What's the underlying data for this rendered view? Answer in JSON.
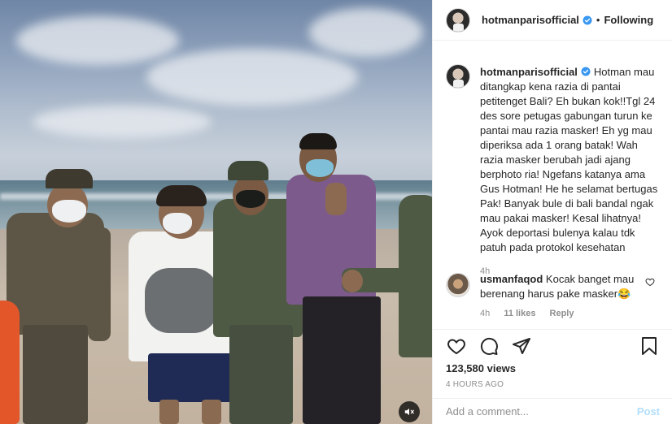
{
  "header": {
    "username": "hotmanparisofficial",
    "separator": "•",
    "follow_label": "Following",
    "avatar_icon": "profile-photo",
    "verified_icon": "verified-badge-icon"
  },
  "caption": {
    "username": "hotmanparisofficial",
    "text": "Hotman mau ditangkap kena razia di pantai petitenget Bali? Eh bukan kok!!Tgl 24 des sore petugas gabungan turun ke pantai mau razia masker! Eh yg mau diperiksa ada 1 orang batak! Wah razia masker berubah jadi ajang berphoto ria! Ngefans katanya ama Gus Hotman! He he selamat bertugas Pak! Banyak bule di bali bandal ngak mau pakai masker! Kesal lihatnya! Ayok deportasi bulenya kalau tdk patuh pada protokol kesehatan",
    "ago": "4h"
  },
  "comments": [
    {
      "username": "usmanfaqod",
      "text": "Kocak banget mau berenang harus pake masker😂",
      "ago": "4h",
      "likes": "11 likes",
      "reply_label": "Reply"
    }
  ],
  "actions": {
    "icons": [
      "heart-icon",
      "comment-icon",
      "share-icon",
      "bookmark-icon"
    ],
    "views": "123,580 views",
    "timestamp": "4 HOURS AGO"
  },
  "add_comment": {
    "placeholder": "Add a comment...",
    "post_label": "Post"
  },
  "media": {
    "type": "video",
    "mute_icon": "muted-speaker-icon"
  },
  "colors": {
    "verified_blue": "#3897f0",
    "post_disabled": "#b2dffc",
    "secondary_text": "#8e8e8e"
  }
}
